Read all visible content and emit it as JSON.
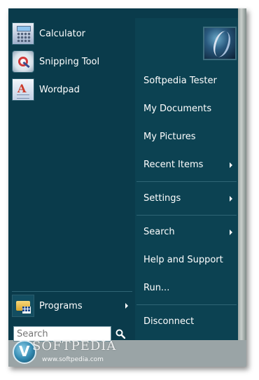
{
  "pinned": [
    {
      "label": "Calculator",
      "icon": "calculator-icon"
    },
    {
      "label": "Snipping Tool",
      "icon": "snipping-tool-icon"
    },
    {
      "label": "Wordpad",
      "icon": "wordpad-icon"
    }
  ],
  "programs": {
    "label": "Programs",
    "icon": "programs-folder-icon"
  },
  "search": {
    "placeholder": "Search",
    "value": ""
  },
  "right": {
    "user_name": "Softpedia Tester",
    "items": [
      {
        "label": "My Documents"
      },
      {
        "label": "My Pictures"
      },
      {
        "label": "Recent Items"
      },
      {
        "label": "Settings"
      },
      {
        "label": "Search"
      },
      {
        "label": "Help and Support"
      },
      {
        "label": "Run..."
      },
      {
        "label": "Disconnect"
      }
    ]
  },
  "watermark": {
    "brand": "SOFTPEDIA",
    "tm": "™",
    "url": "www.softpedia.com"
  },
  "colors": {
    "menu_bg": "#0a3b4b",
    "right_bg": "#0c4252",
    "text": "#ffffff"
  }
}
